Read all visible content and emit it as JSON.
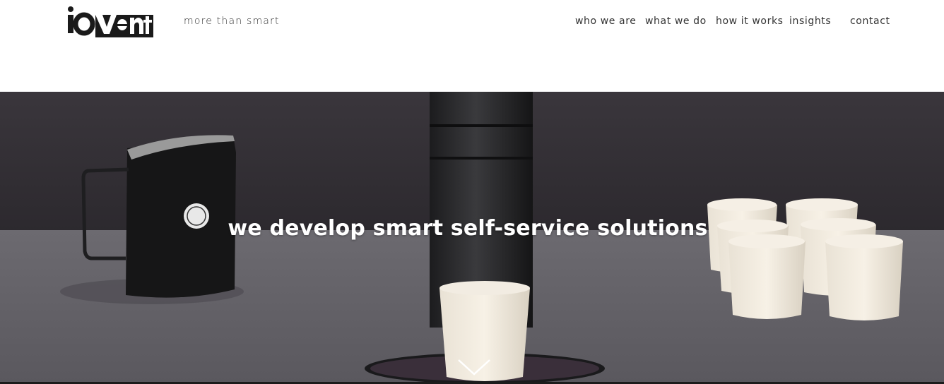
{
  "header": {
    "logo_text": "iovent",
    "tagline": "more than smart",
    "nav": [
      {
        "label": "who we are"
      },
      {
        "label": "what we do"
      },
      {
        "label": "how it works"
      },
      {
        "label": "insights"
      },
      {
        "label": "contact"
      }
    ]
  },
  "hero": {
    "headline": "we develop smart self-service solutions",
    "scroll_icon": "chevron-down-icon"
  }
}
